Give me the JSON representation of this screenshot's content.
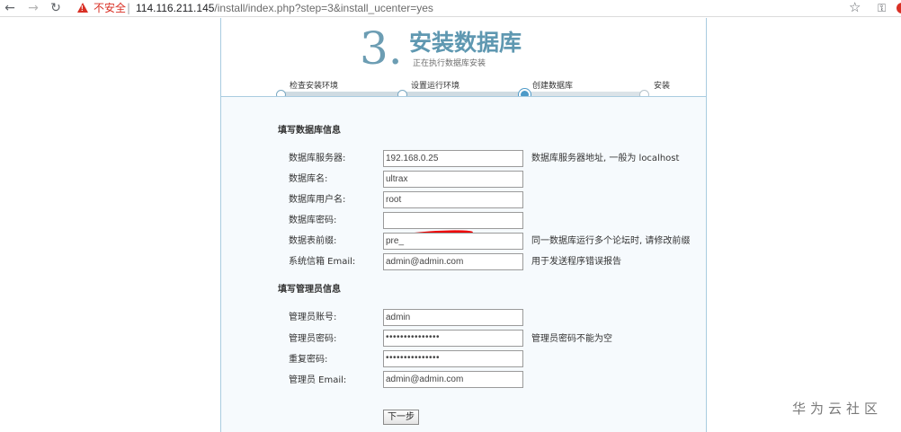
{
  "browser": {
    "back_icon": "←",
    "forward_icon": "→",
    "reload_icon": "↻",
    "insecure_label": "不安全",
    "url_separator": "|",
    "url_host": "114.116.211.145",
    "url_path": "/install/index.php?step=3&install_ucenter=yes",
    "star_icon": "☆",
    "key_icon": "⚿"
  },
  "header": {
    "step_number": "3.",
    "title": "安装数据库",
    "subtitle": "正在执行数据库安装"
  },
  "progress": {
    "steps": [
      {
        "label": "检查安装环境",
        "state": "done"
      },
      {
        "label": "设置运行环境",
        "state": "done"
      },
      {
        "label": "创建数据库",
        "state": "current"
      },
      {
        "label": "安装",
        "state": "pending"
      }
    ]
  },
  "db_section": {
    "title": "填写数据库信息",
    "rows": [
      {
        "label": "数据库服务器:",
        "value": "192.168.0.25",
        "note": "数据库服务器地址, 一般为 localhost"
      },
      {
        "label": "数据库名:",
        "value": "ultrax",
        "note": ""
      },
      {
        "label": "数据库用户名:",
        "value": "root",
        "note": ""
      },
      {
        "label": "数据库密码:",
        "value": "",
        "note": ""
      },
      {
        "label": "数据表前缀:",
        "value": "pre_",
        "note": "同一数据库运行多个论坛时, 请修改前缀"
      },
      {
        "label": "系统信箱 Email:",
        "value": "admin@admin.com",
        "note": "用于发送程序错误报告"
      }
    ]
  },
  "admin_section": {
    "title": "填写管理员信息",
    "rows": [
      {
        "label": "管理员账号:",
        "value": "admin",
        "note": ""
      },
      {
        "label": "管理员密码:",
        "value": "•••••••••••••••",
        "note": "管理员密码不能为空"
      },
      {
        "label": "重复密码:",
        "value": "•••••••••••••••",
        "note": ""
      },
      {
        "label": "管理员 Email:",
        "value": "admin@admin.com",
        "note": ""
      }
    ]
  },
  "next_button": "下一步",
  "watermark": "华为云社区",
  "colors": {
    "accent": "#5f98b1",
    "border": "#a9cce0",
    "content_bg": "#f6fafd",
    "insecure": "#d93025",
    "redaction": "#ee0000"
  }
}
